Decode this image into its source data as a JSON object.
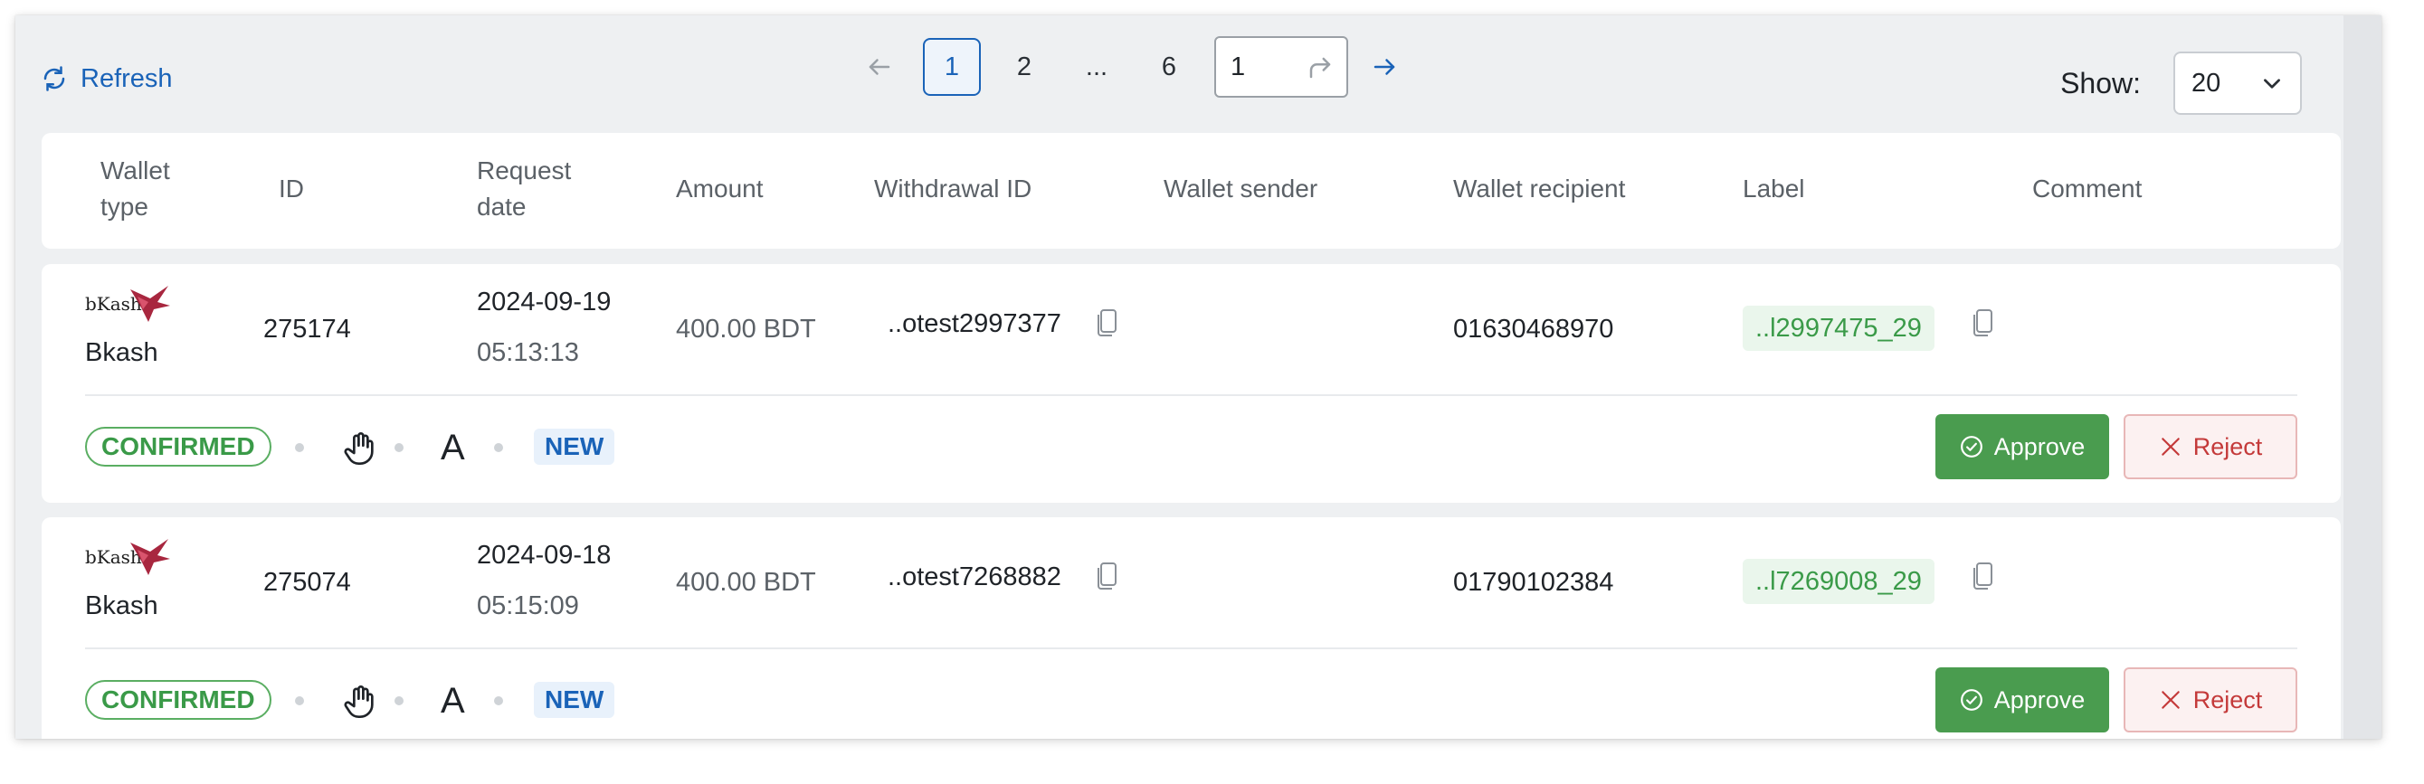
{
  "toolbar": {
    "refresh_label": "Refresh",
    "pages": [
      "1",
      "2",
      "6"
    ],
    "ellipsis": "...",
    "jump_value": "1",
    "show_label": "Show:",
    "page_size": "20"
  },
  "columns": {
    "wallet_type_1": "Wallet",
    "wallet_type_2": "type",
    "id": "ID",
    "request_date_1": "Request",
    "request_date_2": "date",
    "amount": "Amount",
    "withdrawal_id": "Withdrawal ID",
    "wallet_sender": "Wallet sender",
    "wallet_recipient": "Wallet recipient",
    "label": "Label",
    "comment": "Comment"
  },
  "rows": [
    {
      "logo_text": "bKash",
      "wallet_name": "Bkash",
      "id": "275174",
      "date": "2024-09-19",
      "time": "05:13:13",
      "amount": "400.00 BDT",
      "withdrawal_id": "..otest2997377",
      "wallet_recipient": "01630468970",
      "label": "..l2997475_29",
      "status": "CONFIRMED",
      "a_mark": "A",
      "tag": "NEW",
      "approve_label": "Approve",
      "reject_label": "Reject"
    },
    {
      "logo_text": "bKash",
      "wallet_name": "Bkash",
      "id": "275074",
      "date": "2024-09-18",
      "time": "05:15:09",
      "amount": "400.00 BDT",
      "withdrawal_id": "..otest7268882",
      "wallet_recipient": "01790102384",
      "label": "..l7269008_29",
      "status": "CONFIRMED",
      "a_mark": "A",
      "tag": "NEW",
      "approve_label": "Approve",
      "reject_label": "Reject"
    }
  ],
  "colors": {
    "accent": "#1a63b8",
    "success": "#4a9c4f",
    "danger": "#c43a3a",
    "bkash_brand": "#a8273f"
  },
  "icons": {
    "refresh": "refresh-icon",
    "prev": "arrow-left-icon",
    "next": "arrow-right-icon",
    "go": "redo-arrow-icon",
    "select": "chevron-down-icon",
    "copy": "copy-icon",
    "hand": "hand-icon",
    "approve": "check-circle-icon",
    "reject": "close-icon"
  }
}
